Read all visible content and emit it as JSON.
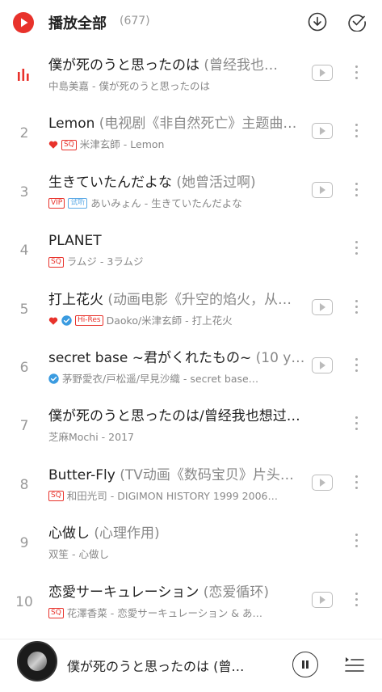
{
  "header": {
    "title": "播放全部",
    "count": "(677)"
  },
  "songs": [
    {
      "index": "",
      "playing": true,
      "title": "僕が死のうと思ったのは",
      "alias": " (曾经我也…",
      "liked": false,
      "verified": false,
      "badges": [],
      "subtitle": "中島美嘉 - 僕が死のうと思ったのは",
      "has_mv": true
    },
    {
      "index": "2",
      "playing": false,
      "title": "Lemon",
      "alias": " (电视剧《非自然死亡》主题曲…",
      "liked": true,
      "verified": false,
      "badges": [
        "SQ"
      ],
      "subtitle": "米津玄師 - Lemon",
      "has_mv": true
    },
    {
      "index": "3",
      "playing": false,
      "title": "生きていたんだよな",
      "alias": " (她曾活过啊)",
      "liked": false,
      "verified": false,
      "badges": [
        "VIP",
        "试听"
      ],
      "subtitle": "あいみょん - 生きていたんだよな",
      "has_mv": true
    },
    {
      "index": "4",
      "playing": false,
      "title": "PLANET",
      "alias": "",
      "liked": false,
      "verified": false,
      "badges": [
        "SQ"
      ],
      "subtitle": "ラムジ - 3ラムジ",
      "has_mv": false
    },
    {
      "index": "5",
      "playing": false,
      "title": "打上花火",
      "alias": " (动画电影《升空的焰火，从…",
      "liked": true,
      "verified": true,
      "badges": [
        "Hi-Res"
      ],
      "subtitle": "Daoko/米津玄師 - 打上花火",
      "has_mv": true
    },
    {
      "index": "6",
      "playing": false,
      "title": "secret base ~君がくれたもの~",
      "alias": " (10 y…",
      "liked": false,
      "verified": true,
      "badges": [],
      "subtitle": "茅野愛衣/戸松遥/早見沙織 - secret base…",
      "has_mv": true
    },
    {
      "index": "7",
      "playing": false,
      "title": "僕が死のうと思ったのは/曾经我也想过一了…",
      "alias": "",
      "liked": false,
      "verified": false,
      "badges": [],
      "subtitle": "芝麻Mochi - 2017",
      "has_mv": false
    },
    {
      "index": "8",
      "playing": false,
      "title": "Butter-Fly",
      "alias": " (TV动画《数码宝贝》片头…",
      "liked": false,
      "verified": false,
      "badges": [
        "SQ"
      ],
      "subtitle": "和田光司 - DIGIMON HISTORY 1999 2006…",
      "has_mv": true
    },
    {
      "index": "9",
      "playing": false,
      "title": "心做し",
      "alias": " (心理作用)",
      "liked": false,
      "verified": false,
      "badges": [],
      "subtitle": "双笙 - 心做し",
      "has_mv": false
    },
    {
      "index": "10",
      "playing": false,
      "title": "恋愛サーキュレーション",
      "alias": " (恋爱循环)",
      "liked": false,
      "verified": false,
      "badges": [
        "SQ"
      ],
      "subtitle": "花澤香菜 - 恋愛サーキュレーション & あ…",
      "has_mv": true
    }
  ],
  "mini_player": {
    "title": "僕が死のうと思ったのは (曾…"
  },
  "colors": {
    "accent": "#e8322b",
    "verified": "#3a9be0",
    "muted": "#888888"
  }
}
